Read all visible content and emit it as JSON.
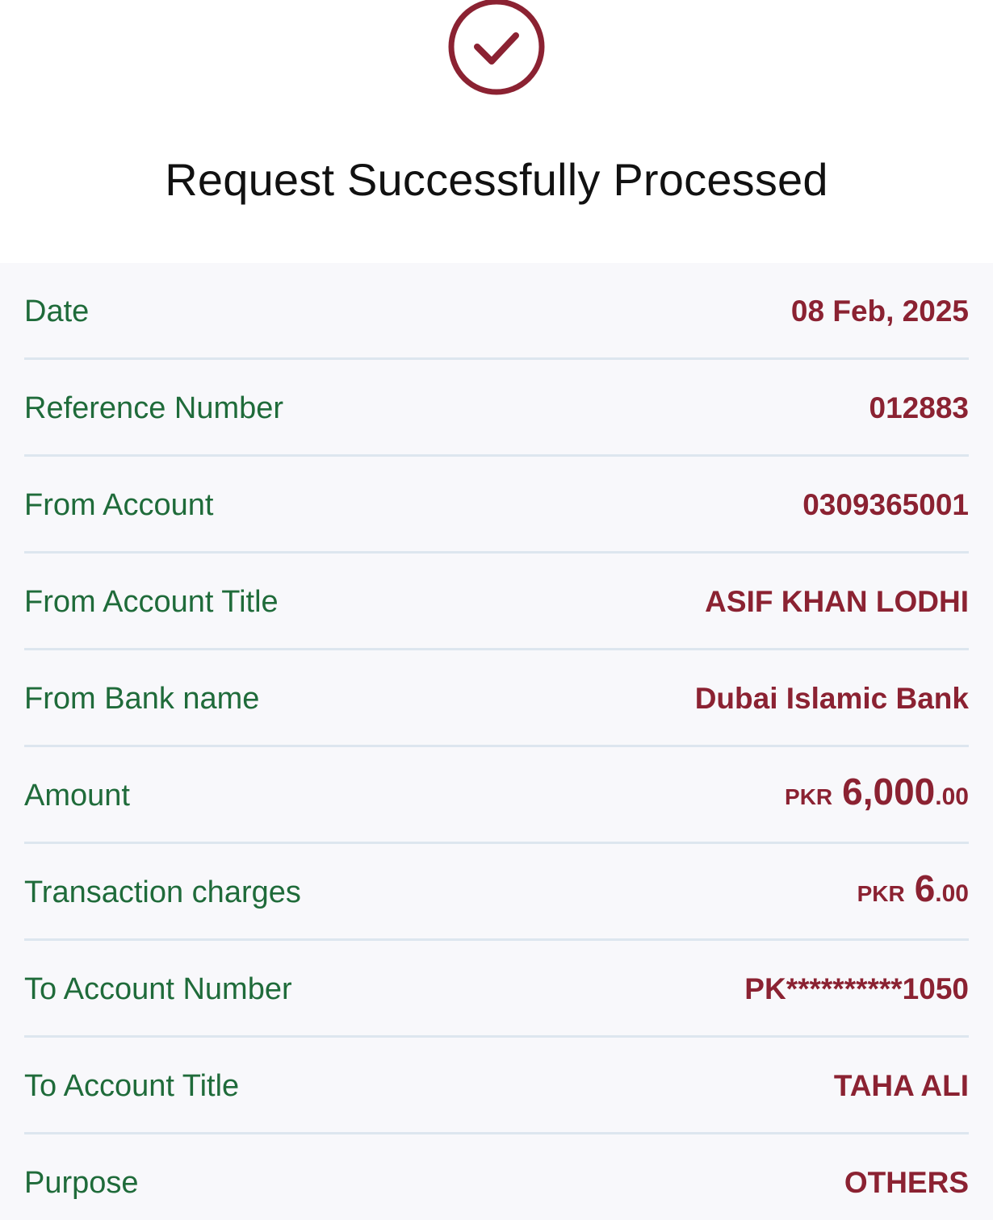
{
  "header": {
    "status_icon": "check-circle-icon",
    "title": "Request Successfully Processed"
  },
  "colors": {
    "accent": "#8b2232",
    "label": "#1f6b3a",
    "divider": "#dde6ef",
    "panel_bg": "#f8f8fb"
  },
  "details": {
    "date": {
      "label": "Date",
      "value": "08 Feb, 2025"
    },
    "reference": {
      "label": "Reference Number",
      "value": "012883"
    },
    "from_account": {
      "label": "From Account",
      "value": "0309365001"
    },
    "from_account_title": {
      "label": "From Account Title",
      "value": "ASIF KHAN LODHI"
    },
    "from_bank": {
      "label": "From Bank name",
      "value": "Dubai Islamic Bank"
    },
    "amount": {
      "label": "Amount",
      "currency": "PKR",
      "main": "6,000",
      "decimal": ".00"
    },
    "charges": {
      "label": "Transaction charges",
      "currency": "PKR",
      "main": "6",
      "decimal": ".00"
    },
    "to_account_number": {
      "label": "To Account Number",
      "value": "PK**********1050"
    },
    "to_account_title": {
      "label": "To Account Title",
      "value": "TAHA ALI"
    },
    "purpose": {
      "label": "Purpose",
      "value": "OTHERS"
    }
  }
}
